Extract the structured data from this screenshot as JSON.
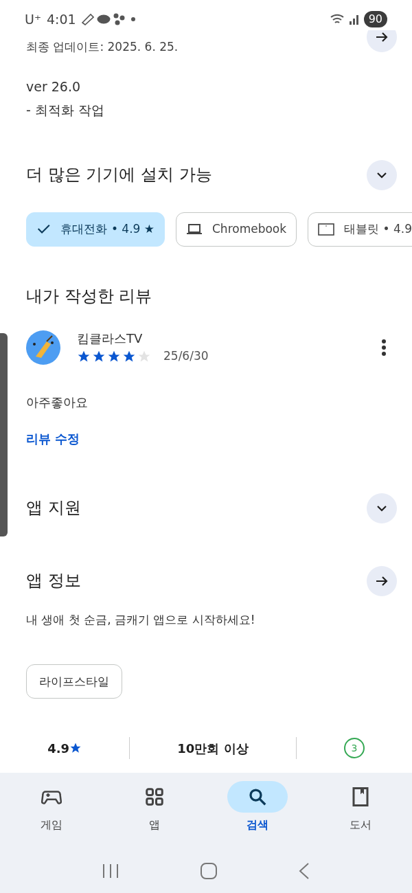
{
  "status_bar": {
    "carrier": "U⁺",
    "time": "4:01",
    "battery": "90"
  },
  "whats_new": {
    "updated": "최종 업데이트: 2025. 6. 25.",
    "version": "ver 26.0",
    "notes": "- 최적화 작업"
  },
  "devices": {
    "title": "더 많은 기기에 설치 가능",
    "expanded": false,
    "chips": [
      {
        "label": "휴대전화 • 4.9 ★",
        "selected": true
      },
      {
        "kind": "laptop",
        "label": "Chromebook",
        "selected": false
      },
      {
        "kind": "tablet",
        "label": "태블릿 • 4.9",
        "selected": false
      }
    ]
  },
  "my_review": {
    "title": "내가 작성한 리뷰",
    "author": "킴클라스TV",
    "stars": 4,
    "date": "25/6/30",
    "text": "아주좋아요",
    "edit_link": "리뷰 수정"
  },
  "app_support": {
    "title": "앱 지원",
    "expanded": false
  },
  "app_info": {
    "title": "앱 정보",
    "description": "내 생애 첫 순금, 금캐기 앱으로 시작하세요!",
    "category": "라이프스타일"
  },
  "stats": [
    {
      "kind": "rating",
      "value": "4.9"
    },
    {
      "kind": "text",
      "value": "10만회 이상"
    },
    {
      "kind": "age",
      "value": "3"
    }
  ],
  "bottom_nav": [
    {
      "kind": "games",
      "label": "게임",
      "selected": false
    },
    {
      "kind": "apps",
      "label": "앱",
      "selected": false
    },
    {
      "kind": "search",
      "label": "검색",
      "selected": true
    },
    {
      "kind": "books",
      "label": "도서",
      "selected": false
    }
  ]
}
